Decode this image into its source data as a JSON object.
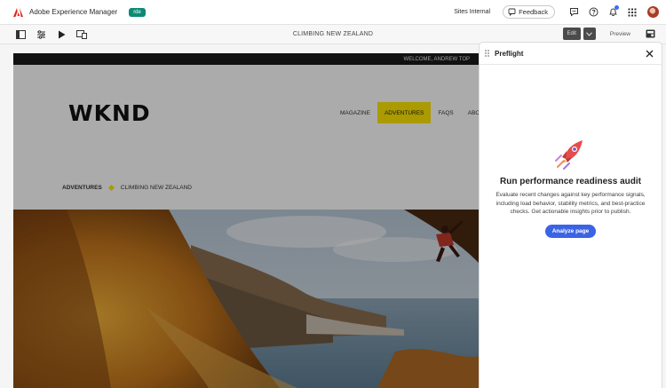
{
  "app": {
    "name": "Adobe Experience Manager",
    "env_badge": "rde",
    "sites_link": "Sites Internal",
    "feedback_label": "Feedback"
  },
  "toolbar": {
    "page_title": "CLIMBING NEW ZEALAND",
    "edit_label": "Edit",
    "preview_label": "Preview"
  },
  "site": {
    "welcome": "WELCOME, ANDREW TOP",
    "logo": "WKND",
    "nav": [
      "MAGAZINE",
      "ADVENTURES",
      "FAQS",
      "ABO"
    ],
    "nav_active_index": 1,
    "breadcrumb": [
      "ADVENTURES",
      "CLIMBING NEW ZEALAND"
    ],
    "accent_color": "#ffe600"
  },
  "panel": {
    "title": "Preflight",
    "heading": "Run performance readiness audit",
    "description": "Evaluate recent changes against key performance signals, including load behavior, stability metrics, and best-practice checks. Get actionable insights prior to publish.",
    "button_label": "Analyze page",
    "accent_color": "#3b63e5"
  }
}
